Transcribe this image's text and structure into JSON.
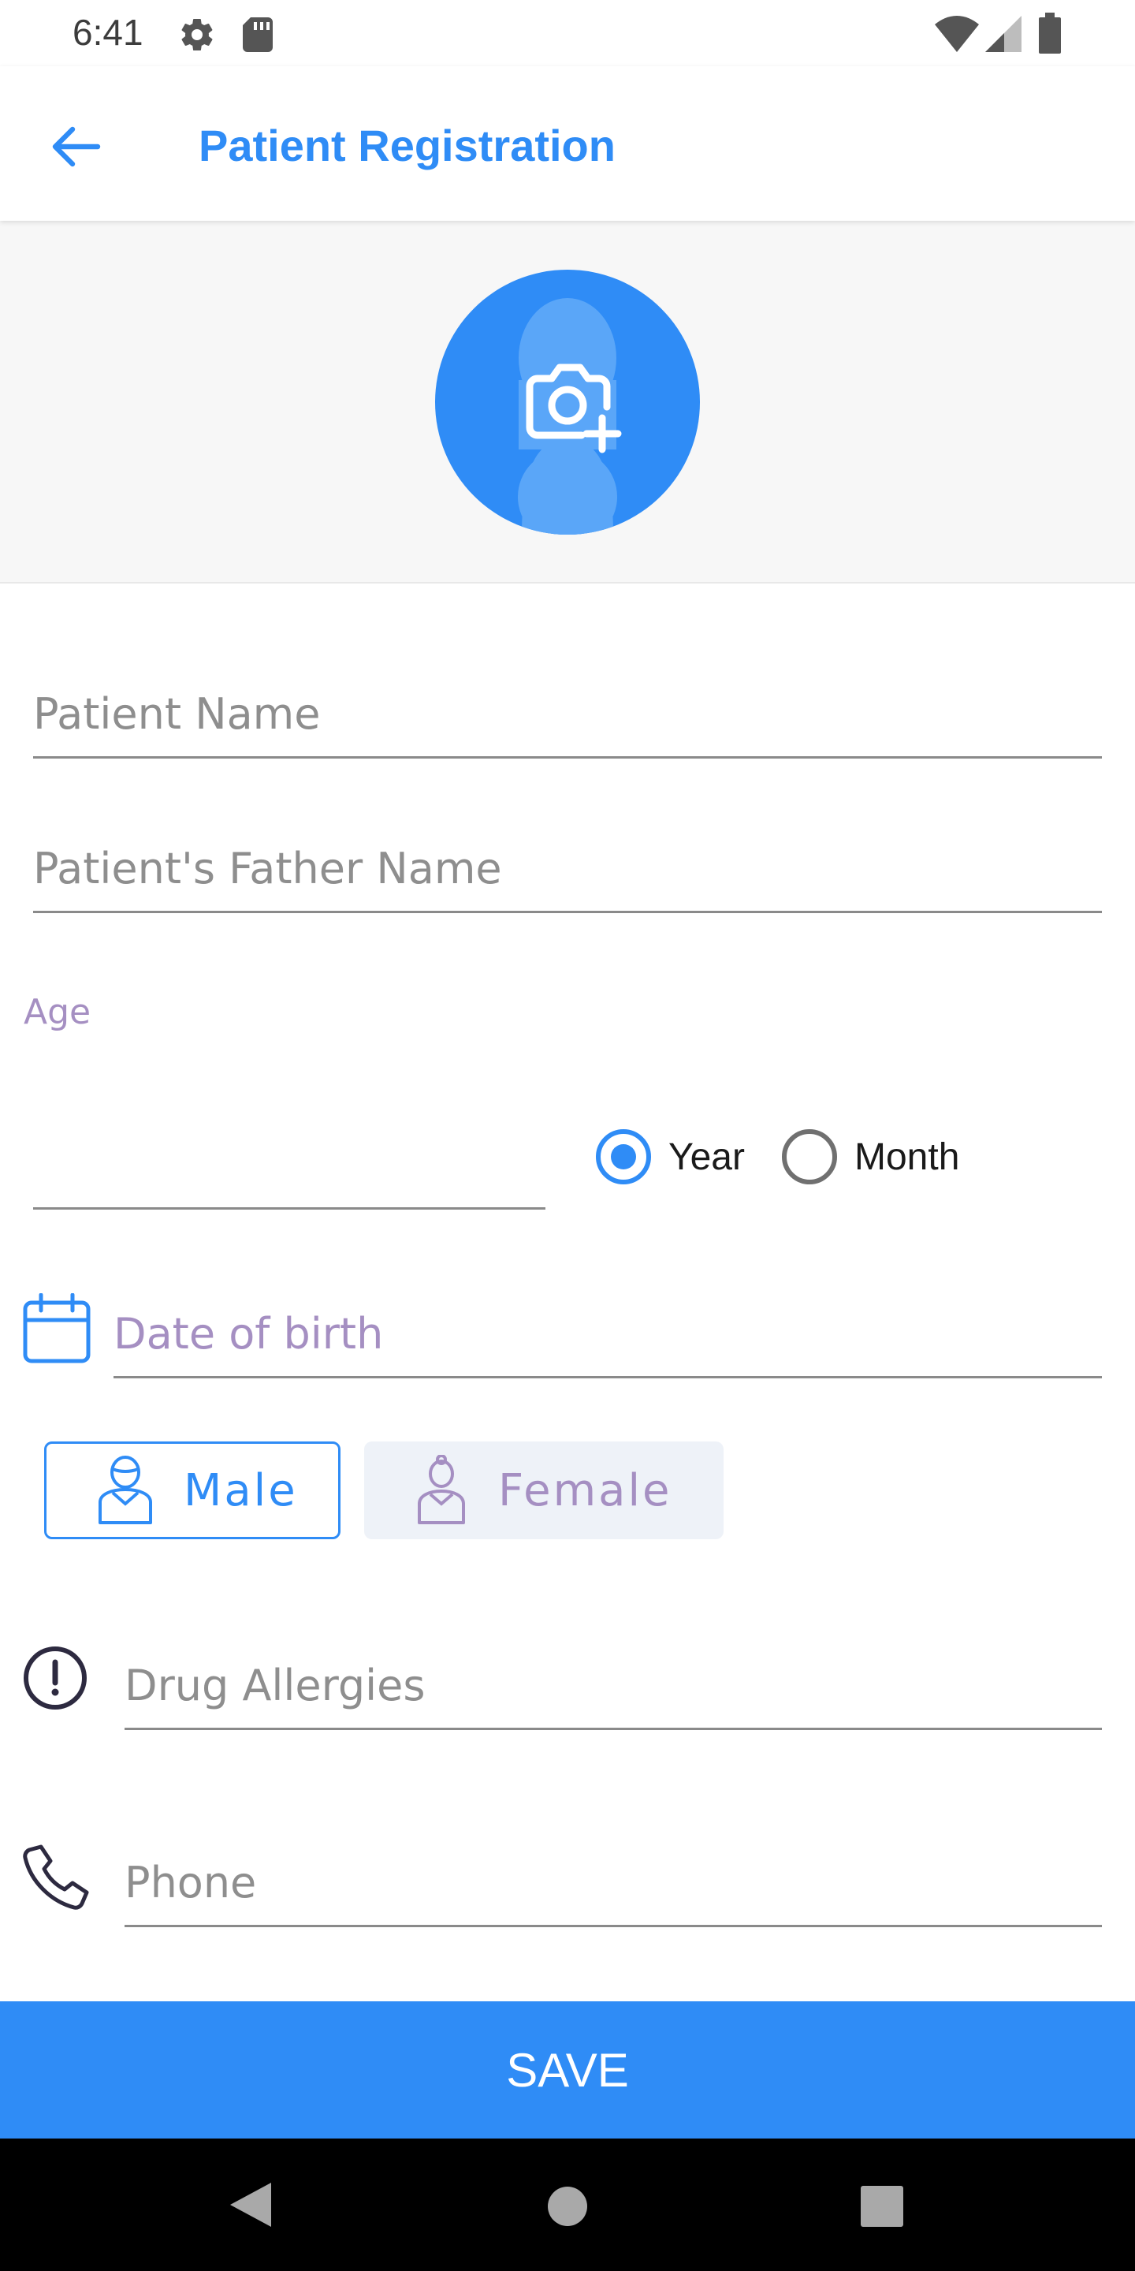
{
  "status_bar": {
    "time": "6:41",
    "icons": [
      "gear-icon",
      "sd-card-icon",
      "wifi-icon",
      "cellular-signal-icon",
      "battery-icon"
    ]
  },
  "app_bar": {
    "title": "Patient Registration",
    "back_icon": "arrow-left-icon"
  },
  "photo": {
    "icon": "camera-add-icon"
  },
  "form": {
    "patient_name_placeholder": "Patient Name",
    "father_name_placeholder": "Patient's Father Name",
    "age_label": "Age",
    "age_value": "",
    "age_unit_options": [
      {
        "label": "Year",
        "selected": true
      },
      {
        "label": "Month",
        "selected": false
      }
    ],
    "dob_placeholder": "Date of birth",
    "gender_options": [
      {
        "label": "Male",
        "selected": true
      },
      {
        "label": "Female",
        "selected": false
      }
    ],
    "allergies_placeholder": "Drug Allergies",
    "phone_placeholder": "Phone"
  },
  "actions": {
    "save_label": "SAVE"
  },
  "colors": {
    "accent": "#2f8cf6",
    "muted_purple": "#a58fc2",
    "placeholder": "#8e8e8e",
    "female_bg": "#eef2f8"
  }
}
